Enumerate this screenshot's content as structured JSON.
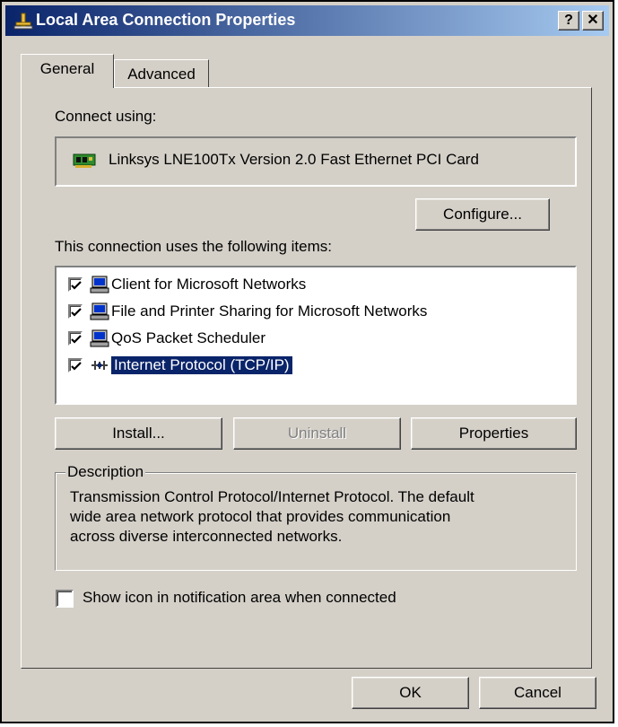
{
  "window": {
    "title": "Local Area Connection Properties"
  },
  "title_buttons": {
    "help": "?",
    "close": "✕"
  },
  "tabs": [
    {
      "label": "General"
    },
    {
      "label": "Advanced"
    }
  ],
  "general": {
    "connect_using_label": "Connect using:",
    "adapter_name": "Linksys LNE100Tx Version 2.0 Fast Ethernet PCI Card",
    "configure_label": "Configure...",
    "items_label": "This connection uses the following items:",
    "items": [
      {
        "label": "Client for Microsoft Networks",
        "checked": true,
        "icon": "network-client-icon"
      },
      {
        "label": "File and Printer Sharing for Microsoft Networks",
        "checked": true,
        "icon": "file-sharing-icon"
      },
      {
        "label": "QoS Packet Scheduler",
        "checked": true,
        "icon": "qos-scheduler-icon"
      },
      {
        "label": "Internet Protocol (TCP/IP)",
        "checked": true,
        "icon": "protocol-icon",
        "selected": true
      }
    ],
    "install_label": "Install...",
    "uninstall_label": "Uninstall",
    "properties_label": "Properties",
    "description_legend": "Description",
    "description_lines": [
      "Transmission Control Protocol/Internet Protocol. The default",
      "wide area network protocol that provides communication",
      "across diverse interconnected networks."
    ],
    "show_icon_label": "Show icon in notification area when connected",
    "show_icon_checked": false
  },
  "footer": {
    "ok_label": "OK",
    "cancel_label": "Cancel"
  },
  "colors": {
    "titlebar_start": "#0a246a",
    "titlebar_end": "#a6caf0",
    "face": "#d4d0c8",
    "selection": "#0a246a"
  }
}
